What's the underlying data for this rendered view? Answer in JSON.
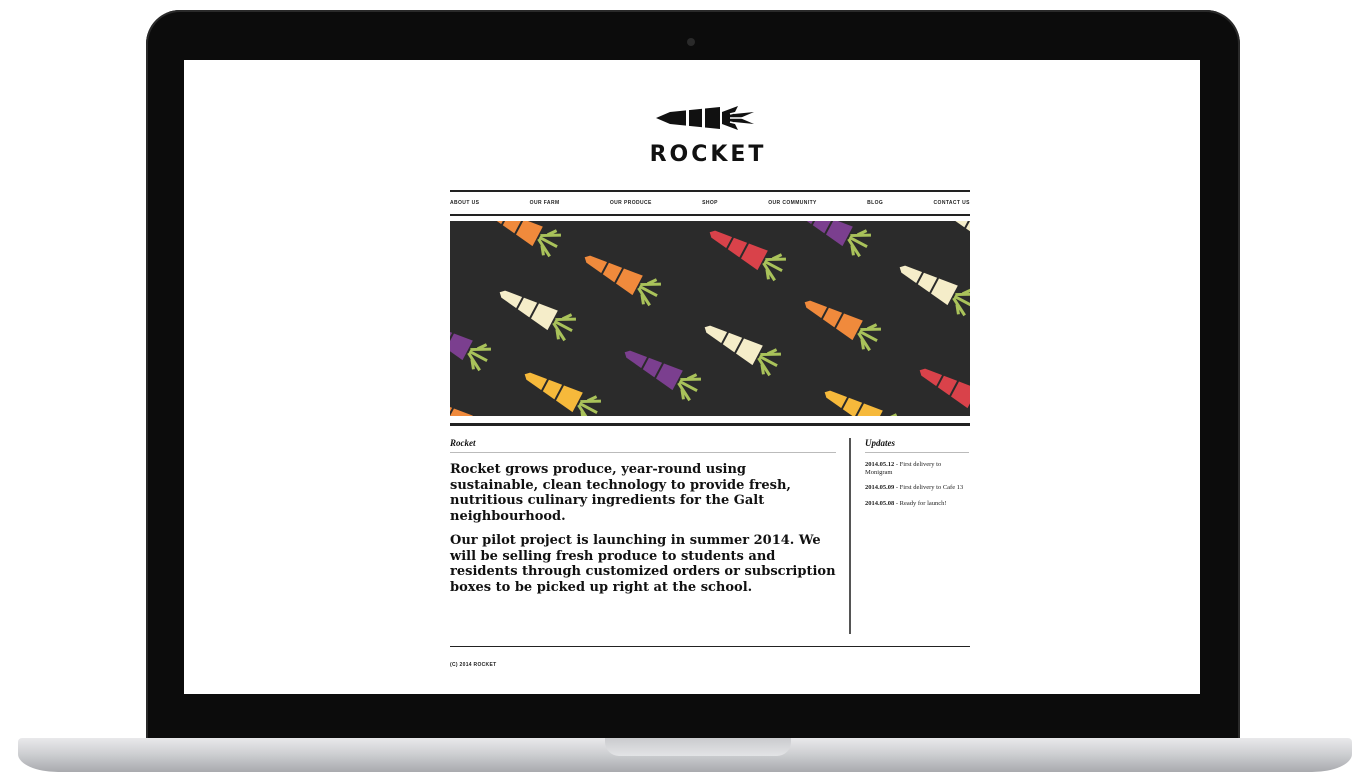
{
  "brand": {
    "name": "ROCKET",
    "logo_icon": "carrot-rocket-logo-icon"
  },
  "nav": {
    "items": [
      {
        "label": "ABOUT US"
      },
      {
        "label": "OUR FARM"
      },
      {
        "label": "OUR PRODUCE"
      },
      {
        "label": "SHOP"
      },
      {
        "label": "OUR COMMUNITY"
      },
      {
        "label": "BLOG"
      },
      {
        "label": "CONTACT US"
      }
    ]
  },
  "hero": {
    "background": "#2b2b2b",
    "carrot_colors": [
      "#f08a3c",
      "#d9424a",
      "#7b3f8f",
      "#f5edc9",
      "#f6b93b"
    ],
    "leaf_color": "#a9c25a"
  },
  "main": {
    "section_label": "Rocket",
    "paragraphs": [
      "Rocket grows produce, year-round using sustainable, clean technology to provide fresh, nutritious culinary ingredients for the Galt neighbourhood.",
      "Our pilot project is launching in summer 2014. We will be selling fresh produce to students and residents through customized orders or subscription boxes to be picked up right at the school."
    ]
  },
  "sidebar": {
    "title": "Updates",
    "updates": [
      {
        "date": "2014.05.12",
        "text": " - First delivery to Monigram"
      },
      {
        "date": "2014.05.09",
        "text": " - First delivery to Cafe 13"
      },
      {
        "date": "2014.05.08",
        "text": " - Ready for launch!"
      }
    ]
  },
  "footer": {
    "copyright": "(C) 2014 ROCKET"
  }
}
